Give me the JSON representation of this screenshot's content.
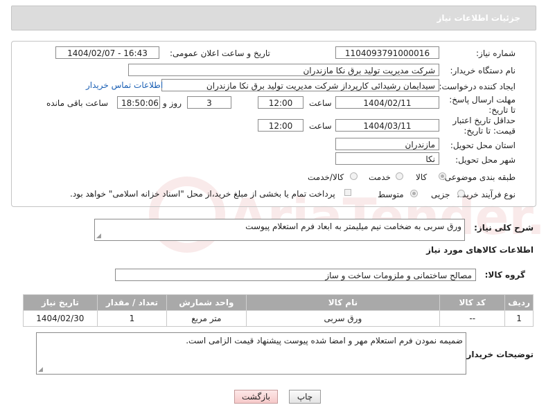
{
  "header": {
    "title": "جزئیات اطلاعات نیاز"
  },
  "form": {
    "need_number": {
      "label": "شماره نیاز:",
      "value": "1104093791000016"
    },
    "announce_datetime": {
      "label": "تاریخ و ساعت اعلان عمومی:",
      "value": "1404/02/07 - 16:43"
    },
    "buyer_org": {
      "label": "نام دستگاه خریدار:",
      "value": "شرکت مدیریت تولید برق نکا  مازندران"
    },
    "requester": {
      "label": "ایجاد کننده درخواست:",
      "value": "سیدایمان رشیدائی کارپرداز شرکت مدیریت تولید برق نکا  مازندران",
      "contact_link": "اطلاعات تماس خریدار"
    },
    "reply_deadline": {
      "label": "مهلت ارسال پاسخ: تا تاریخ:",
      "date": "1404/02/11",
      "time_label": "ساعت",
      "time": "12:00",
      "days": "3",
      "days_label": "روز و",
      "remaining": "18:50:06",
      "remaining_label": "ساعت باقی مانده"
    },
    "price_validity": {
      "label": "حداقل تاریخ اعتبار قیمت: تا تاریخ:",
      "date": "1404/03/11",
      "time_label": "ساعت",
      "time": "12:00"
    },
    "province": {
      "label": "استان محل تحویل:",
      "value": "مازندران"
    },
    "city": {
      "label": "شهر محل تحویل:",
      "value": "نکا"
    },
    "category": {
      "label": "طبقه بندی موضوعی:",
      "options": [
        "کالا",
        "خدمت",
        "کالا/خدمت"
      ],
      "selected": "کالا"
    },
    "purchase_type": {
      "label": "نوع فرآیند خرید :",
      "options": [
        "جزیی",
        "متوسط"
      ],
      "selected": "متوسط",
      "note": "پرداخت تمام یا بخشی از مبلغ خرید،از محل \"اسناد خزانه اسلامی\" خواهد بود."
    }
  },
  "description": {
    "label": "شرح کلی نیاز:",
    "value": "ورق سربی به ضخامت نیم میلیمتر به ابعاد فرم استعلام پیوست"
  },
  "goods_section": {
    "title": "اطلاعات کالاهای مورد نیاز"
  },
  "goods_group": {
    "label": "گروه کالا:",
    "value": "مصالح ساختمانی و ملزومات ساخت و ساز"
  },
  "table": {
    "headers": [
      "ردیف",
      "کد کالا",
      "نام کالا",
      "واحد شمارش",
      "تعداد / مقدار",
      "تاریخ نیاز"
    ],
    "rows": [
      [
        "1",
        "--",
        "ورق سربی",
        "متر مربع",
        "1",
        "1404/02/30"
      ]
    ]
  },
  "buyer_notes": {
    "label": "توضیحات خریدار:",
    "value": "ضمیمه نمودن فرم استعلام مهر و امضا شده پیوست پیشنهاد قیمت الزامی است."
  },
  "buttons": {
    "print": "چاپ",
    "back": "بازگشت"
  },
  "watermark": {
    "text": "AriaTender.net"
  }
}
